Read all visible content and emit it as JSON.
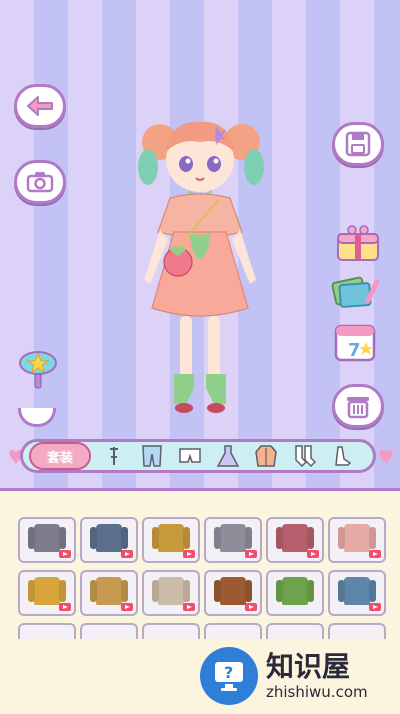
{
  "category_bar": {
    "suit_label": "套装",
    "categories": [
      {
        "icon": "accessory-icon"
      },
      {
        "icon": "pants-icon"
      },
      {
        "icon": "shorts-icon"
      },
      {
        "icon": "dress-icon"
      },
      {
        "icon": "jacket-icon"
      },
      {
        "icon": "socks-icon"
      },
      {
        "icon": "shoes-icon"
      }
    ]
  },
  "side_buttons": {
    "left": [
      "back-arrow-icon",
      "camera-icon",
      "magic-wand-icon"
    ],
    "right": [
      "save-icon",
      "gift-shop-icon",
      "cards-icon",
      "calendar-icon",
      "trash-icon"
    ],
    "calendar_day": "7"
  },
  "colors": {
    "accent": "#b07ac6",
    "suit_button": "#f4a9c4",
    "category_bar": "#cdeff3",
    "panel": "#fbf4de"
  },
  "clothes_items": [
    {
      "color": "#7d7c8c",
      "locked": true
    },
    {
      "color": "#5c708c",
      "locked": true
    },
    {
      "color": "#c99a3c",
      "locked": true
    },
    {
      "color": "#8f8d9a",
      "locked": true
    },
    {
      "color": "#b5606c",
      "locked": true
    },
    {
      "color": "#e7a9a3",
      "locked": true
    },
    {
      "color": "#d7a53c",
      "locked": true
    },
    {
      "color": "#c69a4f",
      "locked": true
    },
    {
      "color": "#cbbca7",
      "locked": true
    },
    {
      "color": "#9c5a32",
      "locked": true
    },
    {
      "color": "#6fa34b",
      "locked": false
    },
    {
      "color": "#5f85a8",
      "locked": true
    }
  ],
  "watermark": {
    "cn": "知识屋",
    "en": "zhishiwu.com"
  }
}
